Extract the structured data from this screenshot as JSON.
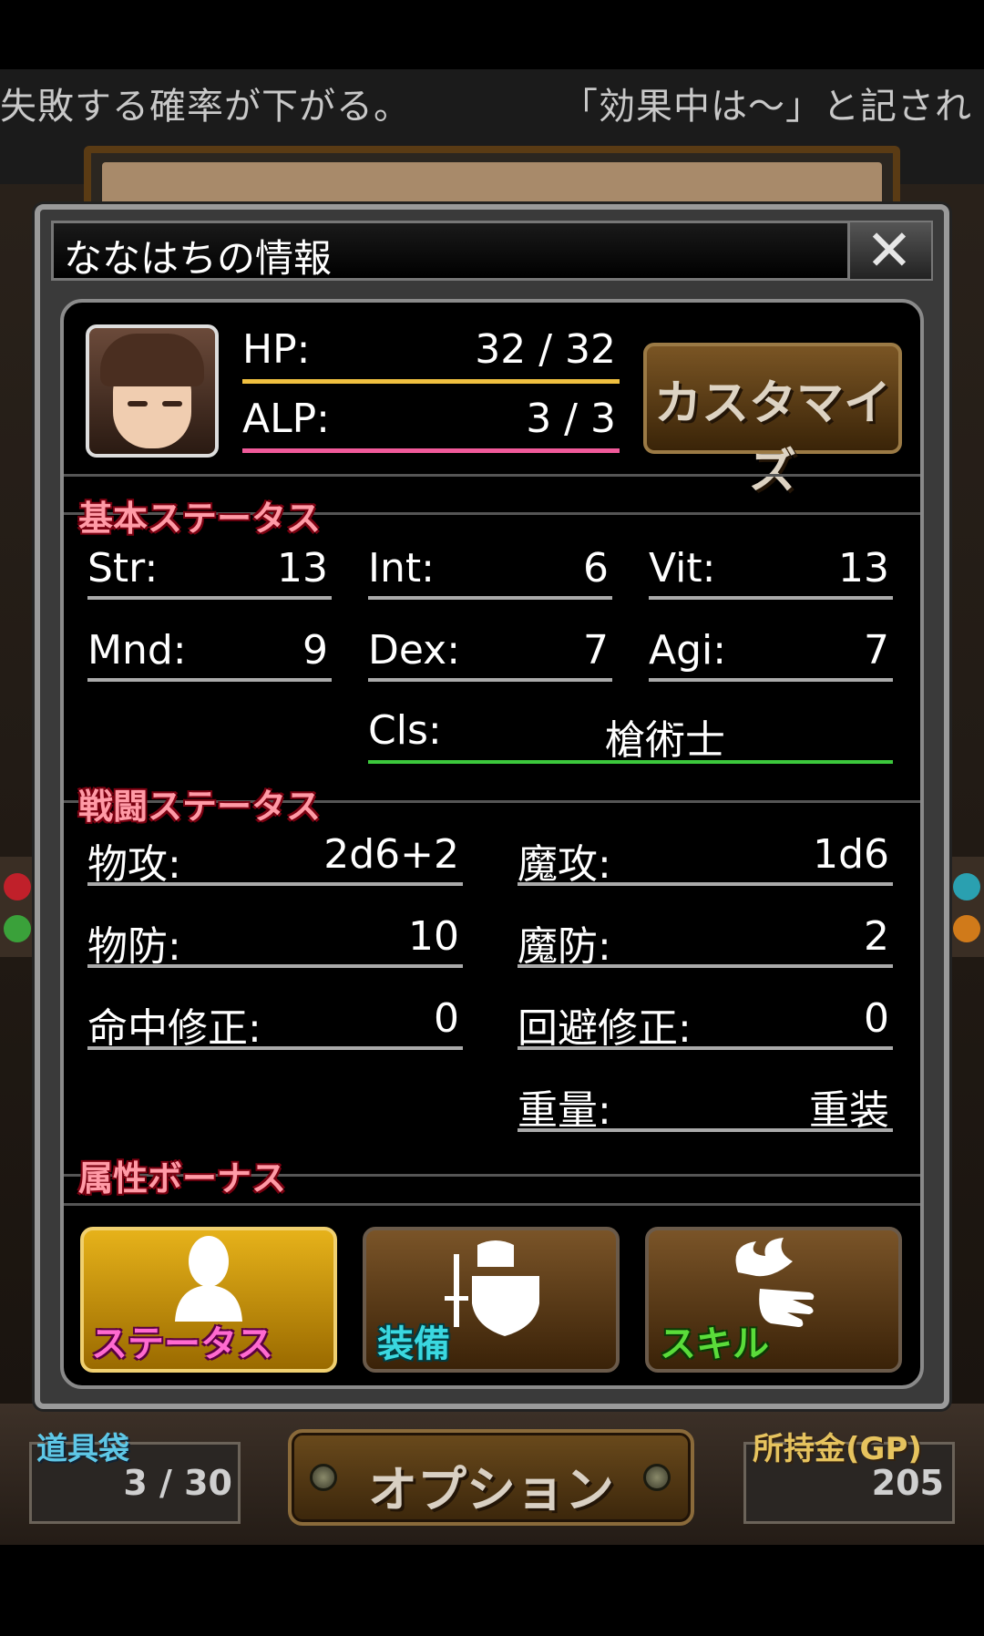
{
  "background": {
    "ticker": "失敗する確率が下がる。　　　　　「効果中は～」と記され"
  },
  "hud": {
    "bag_label": "道具袋",
    "bag_count": "3 / 30",
    "option_label": "オプション",
    "gold_label": "所持金(GP)",
    "gold_value": "205"
  },
  "modal": {
    "title": "ななはちの情報",
    "close_icon": "close-icon",
    "hp_label": "HP:",
    "hp_value": "32 / 32",
    "alp_label": "ALP:",
    "alp_value": "3 / 3",
    "customize_label": "カスタマイズ",
    "basic_header": "基本ステータス",
    "basic": {
      "str_label": "Str:",
      "str_value": "13",
      "int_label": "Int:",
      "int_value": "6",
      "vit_label": "Vit:",
      "vit_value": "13",
      "mnd_label": "Mnd:",
      "mnd_value": "9",
      "dex_label": "Dex:",
      "dex_value": "7",
      "agi_label": "Agi:",
      "agi_value": "7",
      "cls_label": "Cls:",
      "cls_value": "槍術士"
    },
    "battle_header": "戦闘ステータス",
    "battle": {
      "patk_label": "物攻:",
      "patk_value": "2d6+2",
      "matk_label": "魔攻:",
      "matk_value": "1d6",
      "pdef_label": "物防:",
      "pdef_value": "10",
      "mdef_label": "魔防:",
      "mdef_value": "2",
      "hit_label": "命中修正:",
      "hit_value": "0",
      "eva_label": "回避修正:",
      "eva_value": "0",
      "weight_label": "重量:",
      "weight_value": "重装"
    },
    "attr_header": "属性ボーナス",
    "tabs": [
      {
        "label": "ステータス",
        "icon": "person-icon",
        "active": true
      },
      {
        "label": "装備",
        "icon": "knight-shield-icon",
        "active": false
      },
      {
        "label": "スキル",
        "icon": "skill-hand-icon",
        "active": false
      }
    ]
  },
  "colors": {
    "hp_bar": "#f0c040",
    "alp_bar": "#f05a9a",
    "cls_bar": "#3cc83c",
    "section_header": "#ff9aa6",
    "active_tab": "#d9a20a"
  }
}
